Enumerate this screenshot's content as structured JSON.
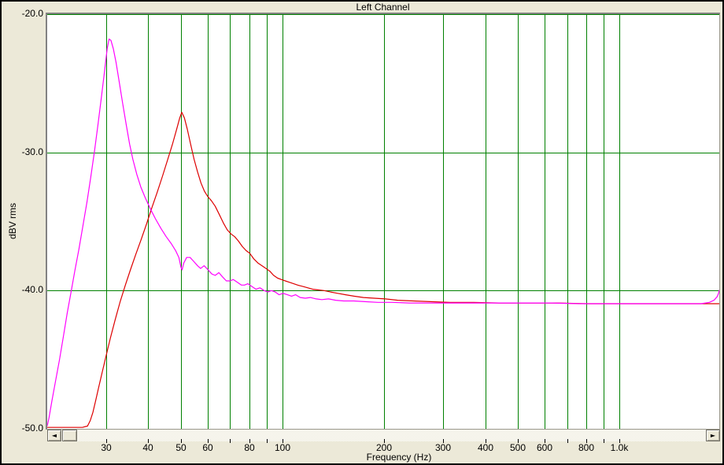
{
  "header": {
    "title": "Left Channel"
  },
  "scrollbar": {
    "left_glyph": "◄",
    "right_glyph": "►"
  },
  "colors": {
    "window_background": "#ece9d8",
    "plot_background": "#ffffff",
    "grid": "#008000",
    "trace_red": "#dd0000",
    "trace_magenta": "#ff00ff",
    "plot_border": "#828282",
    "text": "#000000"
  },
  "chart_data": {
    "type": "line",
    "title": "Left Channel",
    "xlabel": "Frequency (Hz)",
    "ylabel": "dBV rms",
    "legend": false,
    "grid": true,
    "x_axis": {
      "scale": "log",
      "unit": "Hz",
      "min": 20.05,
      "max": 1980,
      "gridlines": [
        30,
        40,
        50,
        60,
        70,
        80,
        90,
        100,
        200,
        300,
        400,
        500,
        600,
        700,
        800,
        900,
        1000
      ],
      "ticks": [
        {
          "f": 30,
          "label": "30"
        },
        {
          "f": 40,
          "label": "40"
        },
        {
          "f": 50,
          "label": "50"
        },
        {
          "f": 60,
          "label": "60"
        },
        {
          "f": 80,
          "label": "80"
        },
        {
          "f": 100,
          "label": "100"
        },
        {
          "f": 200,
          "label": "200"
        },
        {
          "f": 300,
          "label": "300"
        },
        {
          "f": 400,
          "label": "400"
        },
        {
          "f": 500,
          "label": "500"
        },
        {
          "f": 600,
          "label": "600"
        },
        {
          "f": 800,
          "label": "800"
        },
        {
          "f": 1000,
          "label": "1.0k"
        }
      ]
    },
    "y_axis": {
      "scale": "linear",
      "unit": "dBV rms",
      "min": -50,
      "max": -20,
      "gridlines": [
        -20,
        -30,
        -40
      ],
      "ticks": [
        {
          "db": -20,
          "label": "-20.0"
        },
        {
          "db": -30,
          "label": "-30.0"
        },
        {
          "db": -40,
          "label": "-40.0"
        },
        {
          "db": -50,
          "label": "-50.0"
        }
      ]
    },
    "series": [
      {
        "name": "red-trace",
        "color": "#dd0000",
        "points": [
          [
            20.05,
            -49.9
          ],
          [
            23,
            -49.9
          ],
          [
            25.5,
            -49.9
          ],
          [
            26.4,
            -49.8
          ],
          [
            26.9,
            -49.4
          ],
          [
            27.4,
            -48.8
          ],
          [
            27.9,
            -48.0
          ],
          [
            28.5,
            -47.0
          ],
          [
            29.2,
            -45.9
          ],
          [
            30.0,
            -44.7
          ],
          [
            30.9,
            -43.4
          ],
          [
            31.9,
            -42.1
          ],
          [
            33.0,
            -40.8
          ],
          [
            34.2,
            -39.6
          ],
          [
            35.4,
            -38.5
          ],
          [
            36.7,
            -37.4
          ],
          [
            38.1,
            -36.3
          ],
          [
            39.5,
            -35.2
          ],
          [
            41.0,
            -34.0
          ],
          [
            42.5,
            -32.9
          ],
          [
            44.1,
            -31.7
          ],
          [
            45.7,
            -30.5
          ],
          [
            47.2,
            -29.4
          ],
          [
            48.6,
            -28.3
          ],
          [
            49.6,
            -27.5
          ],
          [
            50.3,
            -27.1
          ],
          [
            51.2,
            -27.5
          ],
          [
            52.2,
            -28.3
          ],
          [
            53.4,
            -29.4
          ],
          [
            54.7,
            -30.5
          ],
          [
            56.0,
            -31.4
          ],
          [
            57.3,
            -32.2
          ],
          [
            58.7,
            -32.8
          ],
          [
            60.1,
            -33.2
          ],
          [
            61.6,
            -33.5
          ],
          [
            63.2,
            -33.9
          ],
          [
            65.0,
            -34.5
          ],
          [
            66.8,
            -35.1
          ],
          [
            68.6,
            -35.6
          ],
          [
            70.4,
            -35.9
          ],
          [
            72.2,
            -36.1
          ],
          [
            74.0,
            -36.4
          ],
          [
            76.0,
            -36.8
          ],
          [
            78.0,
            -37.1
          ],
          [
            80.0,
            -37.3
          ],
          [
            82.2,
            -37.7
          ],
          [
            84.6,
            -38.0
          ],
          [
            87.0,
            -38.2
          ],
          [
            89.4,
            -38.4
          ],
          [
            91.8,
            -38.6
          ],
          [
            94.2,
            -38.9
          ],
          [
            96.8,
            -39.1
          ],
          [
            99.4,
            -39.2
          ],
          [
            102,
            -39.3
          ],
          [
            105,
            -39.4
          ],
          [
            108,
            -39.5
          ],
          [
            111,
            -39.6
          ],
          [
            115,
            -39.7
          ],
          [
            119,
            -39.8
          ],
          [
            123,
            -39.9
          ],
          [
            128,
            -39.95
          ],
          [
            133,
            -40.0
          ],
          [
            139,
            -40.1
          ],
          [
            146,
            -40.2
          ],
          [
            154,
            -40.3
          ],
          [
            163,
            -40.4
          ],
          [
            174,
            -40.5
          ],
          [
            187,
            -40.55
          ],
          [
            202,
            -40.6
          ],
          [
            220,
            -40.7
          ],
          [
            245,
            -40.75
          ],
          [
            275,
            -40.8
          ],
          [
            315,
            -40.85
          ],
          [
            370,
            -40.85
          ],
          [
            440,
            -40.9
          ],
          [
            530,
            -40.9
          ],
          [
            650,
            -40.9
          ],
          [
            800,
            -40.95
          ],
          [
            980,
            -40.95
          ],
          [
            1200,
            -40.95
          ],
          [
            1450,
            -40.95
          ],
          [
            1700,
            -40.95
          ],
          [
            1980,
            -40.95
          ]
        ]
      },
      {
        "name": "magenta-trace",
        "color": "#ff00ff",
        "points": [
          [
            20.05,
            -49.8
          ],
          [
            20.3,
            -49.2
          ],
          [
            20.7,
            -48.0
          ],
          [
            21.2,
            -46.6
          ],
          [
            21.8,
            -45.0
          ],
          [
            22.4,
            -43.3
          ],
          [
            23.0,
            -41.6
          ],
          [
            23.6,
            -40.1
          ],
          [
            24.2,
            -38.6
          ],
          [
            24.9,
            -37.0
          ],
          [
            25.6,
            -35.3
          ],
          [
            26.3,
            -33.6
          ],
          [
            27.0,
            -31.8
          ],
          [
            27.7,
            -29.9
          ],
          [
            28.4,
            -27.9
          ],
          [
            29.1,
            -25.8
          ],
          [
            29.7,
            -24.0
          ],
          [
            30.2,
            -22.5
          ],
          [
            30.6,
            -21.8
          ],
          [
            31.0,
            -21.9
          ],
          [
            31.5,
            -22.5
          ],
          [
            32.1,
            -23.5
          ],
          [
            32.8,
            -24.9
          ],
          [
            33.6,
            -26.5
          ],
          [
            34.4,
            -28.0
          ],
          [
            35.2,
            -29.4
          ],
          [
            36.0,
            -30.5
          ],
          [
            37.0,
            -31.6
          ],
          [
            38.0,
            -32.5
          ],
          [
            39.2,
            -33.3
          ],
          [
            40.6,
            -34.1
          ],
          [
            42.0,
            -34.8
          ],
          [
            43.6,
            -35.5
          ],
          [
            45.2,
            -36.1
          ],
          [
            46.8,
            -36.6
          ],
          [
            48.2,
            -37.1
          ],
          [
            49.3,
            -37.6
          ],
          [
            50.0,
            -38.3
          ],
          [
            50.4,
            -38.5
          ],
          [
            51.0,
            -38.0
          ],
          [
            52.0,
            -37.6
          ],
          [
            53.2,
            -37.6
          ],
          [
            54.6,
            -37.9
          ],
          [
            56.0,
            -38.2
          ],
          [
            57.2,
            -38.4
          ],
          [
            58.6,
            -38.2
          ],
          [
            60.2,
            -38.5
          ],
          [
            61.8,
            -38.8
          ],
          [
            63.2,
            -38.9
          ],
          [
            64.8,
            -38.7
          ],
          [
            66.4,
            -39.0
          ],
          [
            68.2,
            -39.3
          ],
          [
            69.8,
            -39.3
          ],
          [
            71.5,
            -39.2
          ],
          [
            73.5,
            -39.4
          ],
          [
            75.5,
            -39.6
          ],
          [
            77.2,
            -39.6
          ],
          [
            79.0,
            -39.5
          ],
          [
            81.2,
            -39.7
          ],
          [
            83.5,
            -39.9
          ],
          [
            85.8,
            -39.8
          ],
          [
            88.2,
            -40.0
          ],
          [
            90.6,
            -40.1
          ],
          [
            92.8,
            -40.0
          ],
          [
            95.2,
            -40.1
          ],
          [
            97.8,
            -40.3
          ],
          [
            100.5,
            -40.2
          ],
          [
            103.5,
            -40.3
          ],
          [
            106.5,
            -40.4
          ],
          [
            109.5,
            -40.3
          ],
          [
            113,
            -40.5
          ],
          [
            117,
            -40.55
          ],
          [
            121,
            -40.5
          ],
          [
            126,
            -40.6
          ],
          [
            131,
            -40.65
          ],
          [
            137,
            -40.6
          ],
          [
            144,
            -40.7
          ],
          [
            152,
            -40.75
          ],
          [
            163,
            -40.75
          ],
          [
            176,
            -40.8
          ],
          [
            192,
            -40.85
          ],
          [
            212,
            -40.85
          ],
          [
            238,
            -40.9
          ],
          [
            270,
            -40.9
          ],
          [
            310,
            -40.9
          ],
          [
            360,
            -40.9
          ],
          [
            430,
            -40.9
          ],
          [
            520,
            -40.9
          ],
          [
            630,
            -40.9
          ],
          [
            760,
            -40.95
          ],
          [
            900,
            -40.95
          ],
          [
            1060,
            -40.95
          ],
          [
            1240,
            -40.95
          ],
          [
            1430,
            -40.95
          ],
          [
            1600,
            -40.95
          ],
          [
            1750,
            -40.95
          ],
          [
            1850,
            -40.85
          ],
          [
            1910,
            -40.7
          ],
          [
            1950,
            -40.45
          ],
          [
            1970,
            -40.2
          ],
          [
            1980,
            -39.95
          ]
        ]
      }
    ]
  }
}
